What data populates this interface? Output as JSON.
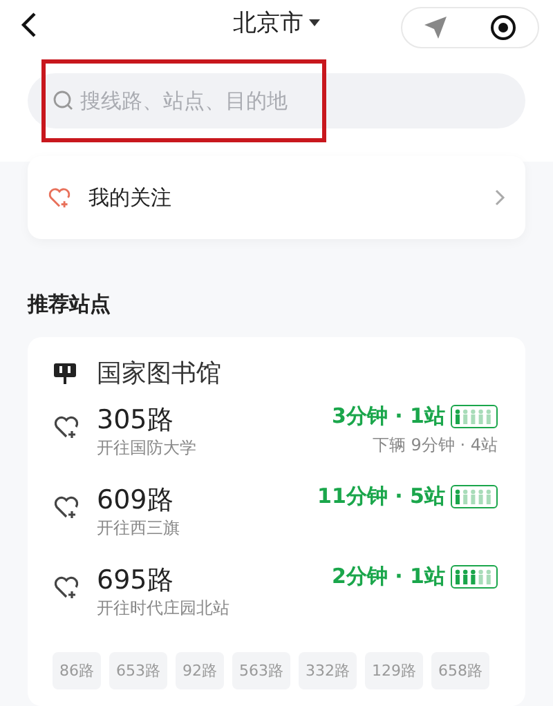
{
  "header": {
    "city": "北京市"
  },
  "search": {
    "placeholder": "搜线路、站点、目的地",
    "highlighted": true
  },
  "favorites": {
    "label": "我的关注"
  },
  "section_title": "推荐站点",
  "station": {
    "name": "国家图书馆",
    "lines": [
      {
        "name": "305路",
        "direction": "开往国防大学",
        "arrival": "3分钟 · 1站",
        "level": 0.2,
        "next": "下辆 9分钟 · 4站"
      },
      {
        "name": "609路",
        "direction": "开往西三旗",
        "arrival": "11分钟 · 5站",
        "level": 0.2
      },
      {
        "name": "695路",
        "direction": "开往时代庄园北站",
        "arrival": "2分钟 · 1站",
        "level": 0.6
      }
    ],
    "chips": [
      "86路",
      "653路",
      "92路",
      "563路",
      "332路",
      "129路",
      "658路"
    ]
  }
}
